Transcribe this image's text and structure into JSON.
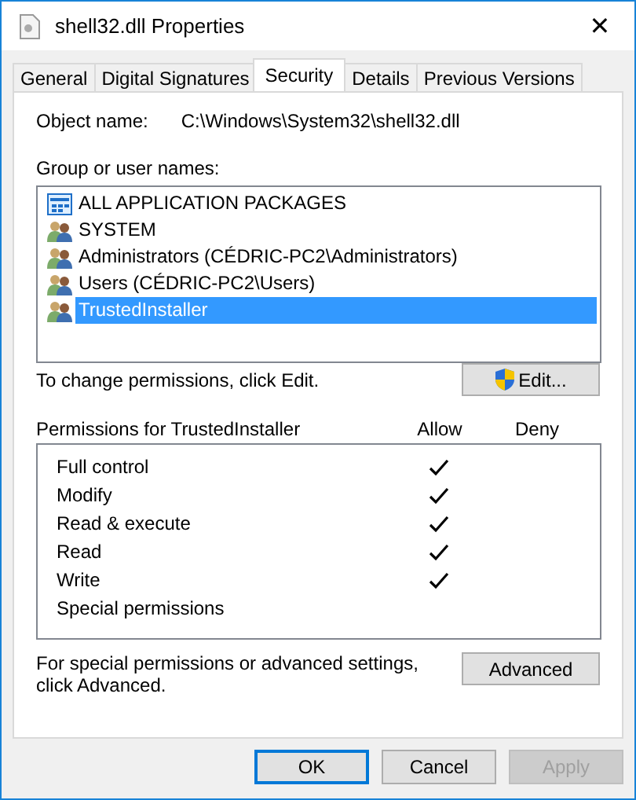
{
  "window": {
    "title": "shell32.dll Properties",
    "close": "✕"
  },
  "tabs": [
    {
      "label": "General",
      "selected": false
    },
    {
      "label": "Digital Signatures",
      "selected": false
    },
    {
      "label": "Security",
      "selected": true
    },
    {
      "label": "Details",
      "selected": false
    },
    {
      "label": "Previous Versions",
      "selected": false
    }
  ],
  "object_name": {
    "label": "Object name:",
    "value": "C:\\Windows\\System32\\shell32.dll"
  },
  "groups": {
    "label": "Group or user names:",
    "items": [
      {
        "kind": "package",
        "name": "ALL APPLICATION PACKAGES",
        "selected": false
      },
      {
        "kind": "users",
        "name": "SYSTEM",
        "selected": false
      },
      {
        "kind": "users",
        "name": "Administrators (CÉDRIC-PC2\\Administrators)",
        "selected": false
      },
      {
        "kind": "users",
        "name": "Users (CÉDRIC-PC2\\Users)",
        "selected": false
      },
      {
        "kind": "users",
        "name": "TrustedInstaller",
        "selected": true
      }
    ]
  },
  "edit_hint": "To change permissions, click Edit.",
  "edit_button": "Edit...",
  "permissions": {
    "label": "Permissions for TrustedInstaller",
    "allow_header": "Allow",
    "deny_header": "Deny",
    "rows": [
      {
        "name": "Full control",
        "allow": true,
        "deny": false
      },
      {
        "name": "Modify",
        "allow": true,
        "deny": false
      },
      {
        "name": "Read & execute",
        "allow": true,
        "deny": false
      },
      {
        "name": "Read",
        "allow": true,
        "deny": false
      },
      {
        "name": "Write",
        "allow": true,
        "deny": false
      },
      {
        "name": "Special permissions",
        "allow": false,
        "deny": false
      }
    ]
  },
  "advanced_hint": "For special permissions or advanced settings, click Advanced.",
  "advanced_button": "Advanced",
  "buttons": [
    {
      "label": "OK",
      "default": true,
      "disabled": false
    },
    {
      "label": "Cancel",
      "default": false,
      "disabled": false
    },
    {
      "label": "Apply",
      "default": false,
      "disabled": true
    }
  ]
}
